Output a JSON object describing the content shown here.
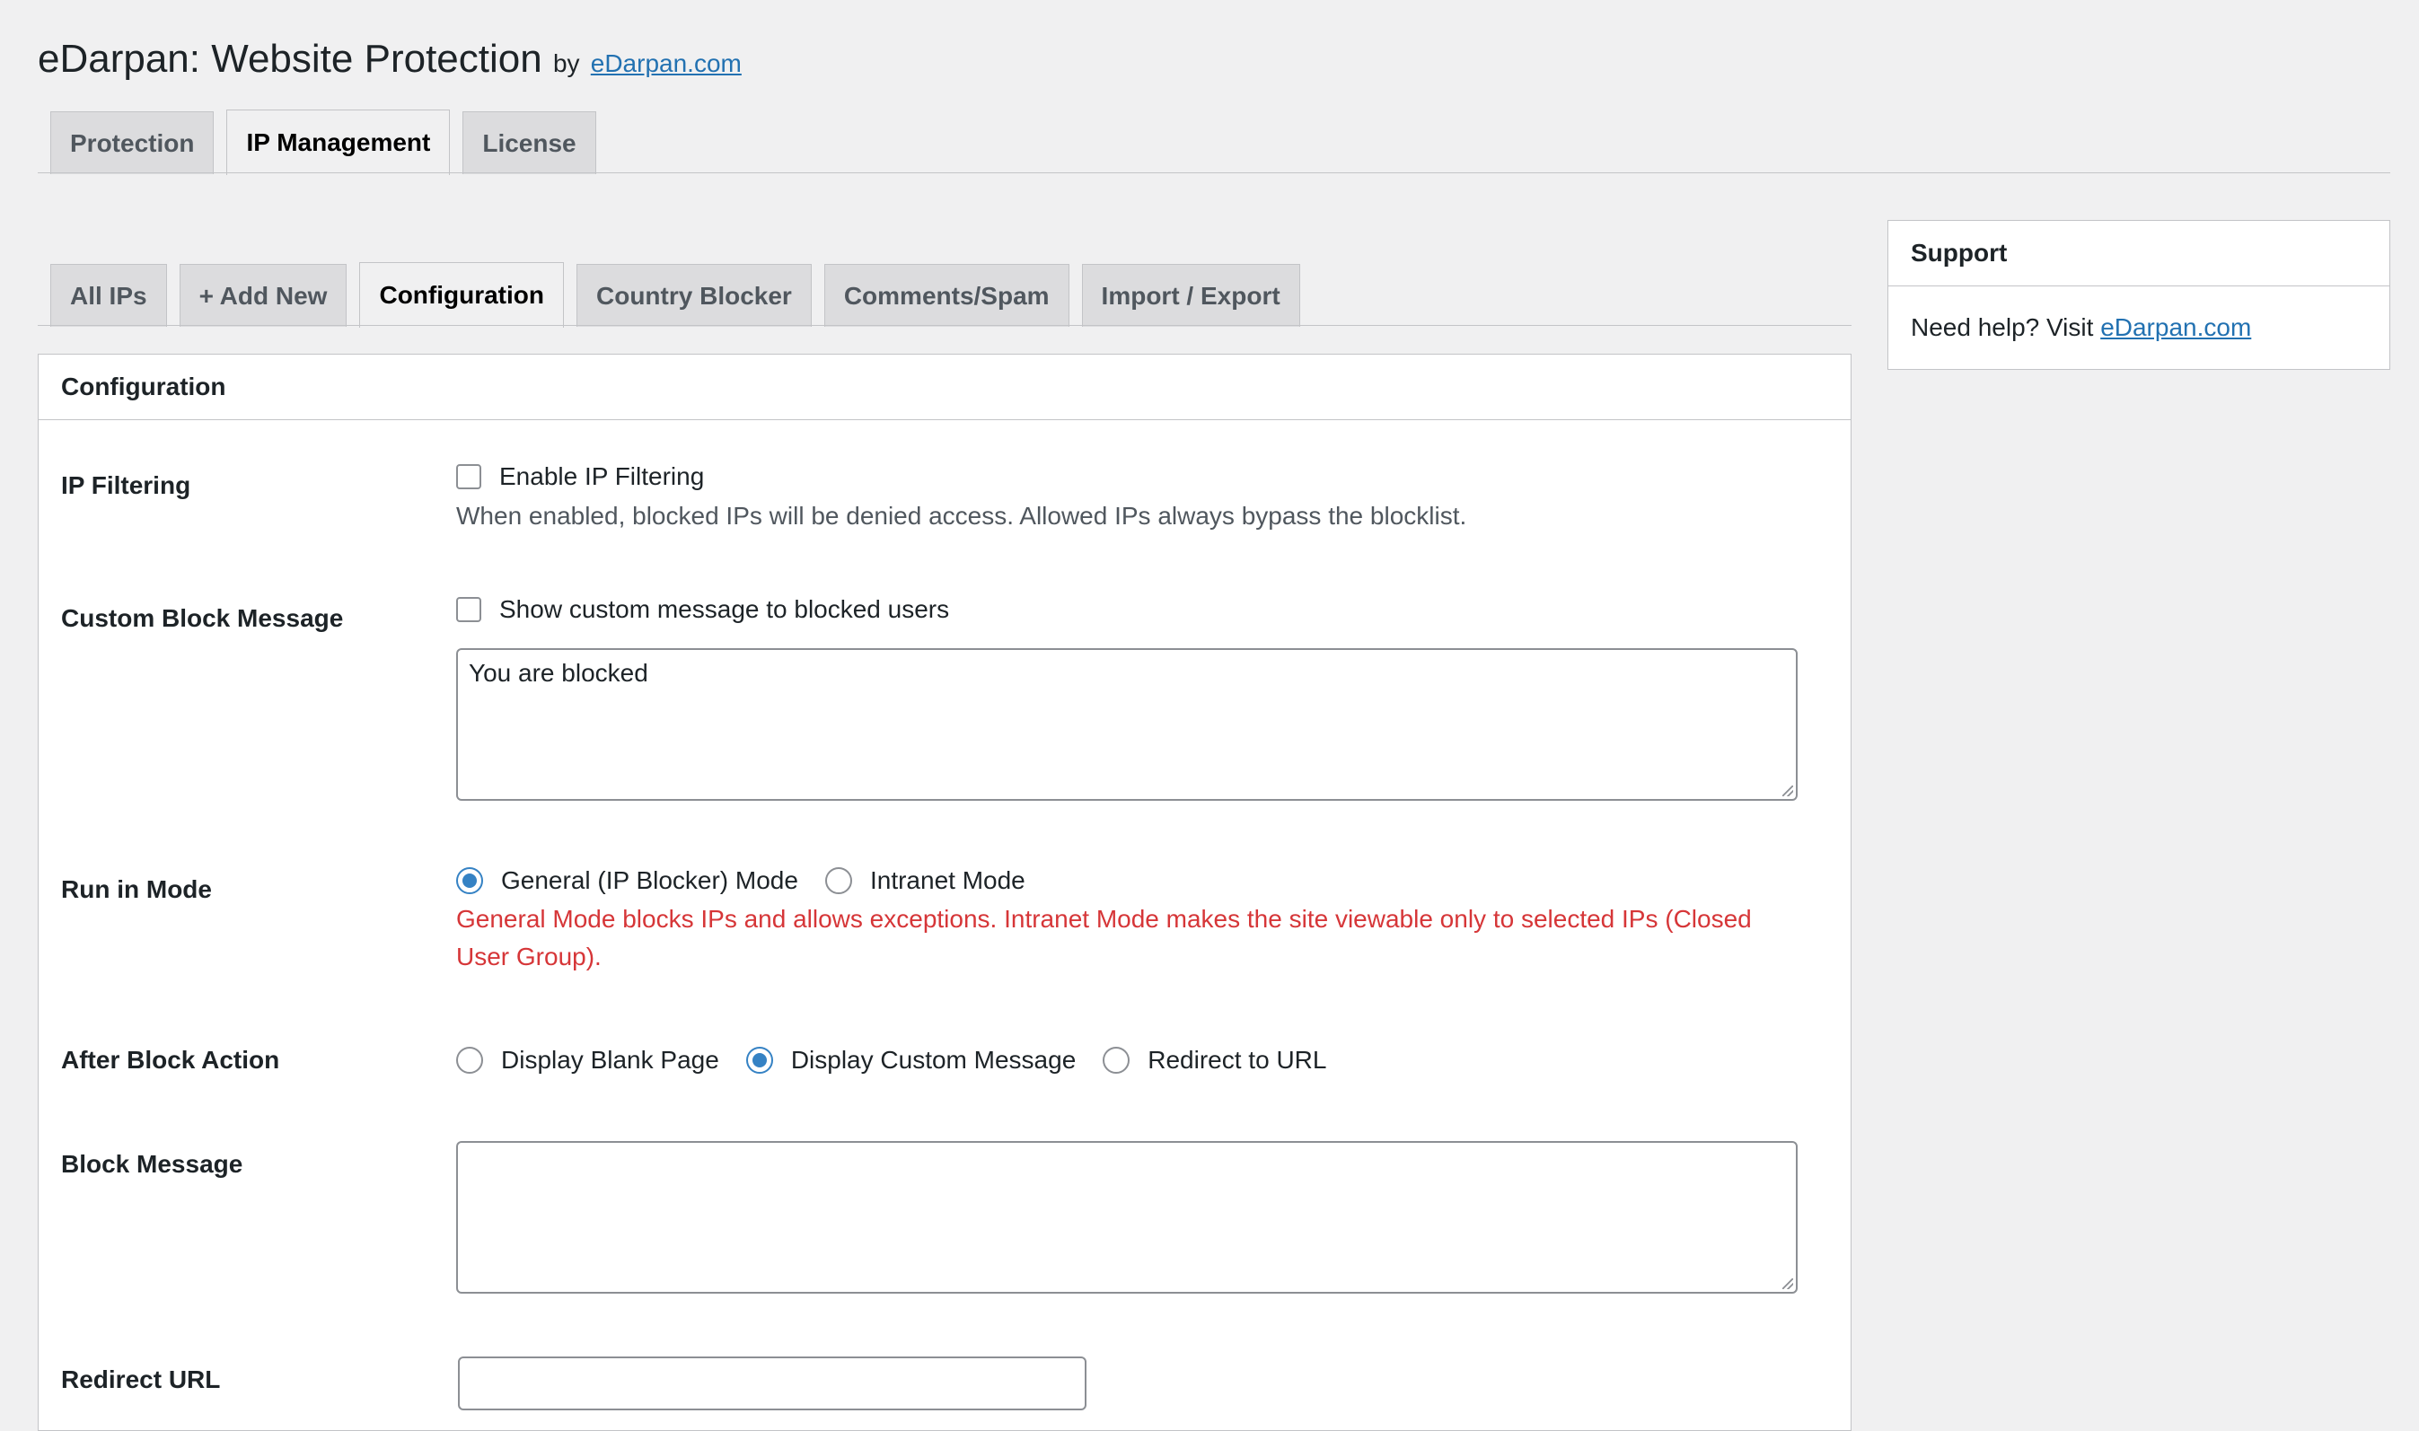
{
  "header": {
    "title": "eDarpan: Website Protection",
    "by_text": "by",
    "by_link": "eDarpan.com"
  },
  "main_tabs": [
    {
      "label": "Protection",
      "active": false
    },
    {
      "label": "IP Management",
      "active": true
    },
    {
      "label": "License",
      "active": false
    }
  ],
  "sub_tabs": [
    {
      "label": "All IPs",
      "active": false
    },
    {
      "label": "+ Add New",
      "active": false
    },
    {
      "label": "Configuration",
      "active": true
    },
    {
      "label": "Country Blocker",
      "active": false
    },
    {
      "label": "Comments/Spam",
      "active": false
    },
    {
      "label": "Import / Export",
      "active": false
    }
  ],
  "config": {
    "heading": "Configuration",
    "ip_filtering": {
      "label": "IP Filtering",
      "checkbox_label": "Enable IP Filtering",
      "checked": false,
      "description": "When enabled, blocked IPs will be denied access. Allowed IPs always bypass the blocklist."
    },
    "custom_block_message": {
      "label": "Custom Block Message",
      "checkbox_label": "Show custom message to blocked users",
      "checked": false,
      "textarea_value": "You are blocked"
    },
    "run_mode": {
      "label": "Run in Mode",
      "options": [
        "General (IP Blocker) Mode",
        "Intranet Mode"
      ],
      "selected": "General (IP Blocker) Mode",
      "warning": "General Mode blocks IPs and allows exceptions. Intranet Mode makes the site viewable only to selected IPs (Closed User Group)."
    },
    "after_block_action": {
      "label": "After Block Action",
      "options": [
        "Display Blank Page",
        "Display Custom Message",
        "Redirect to URL"
      ],
      "selected": "Display Custom Message"
    },
    "block_message": {
      "label": "Block Message",
      "textarea_value": ""
    },
    "redirect_url": {
      "label": "Redirect URL",
      "value": ""
    }
  },
  "support": {
    "heading": "Support",
    "text": "Need help? Visit",
    "link": "eDarpan.com"
  },
  "colors": {
    "background": "#f0f0f1",
    "link": "#2271b1",
    "warning": "#d63638",
    "radio_checked": "#3582c4"
  }
}
